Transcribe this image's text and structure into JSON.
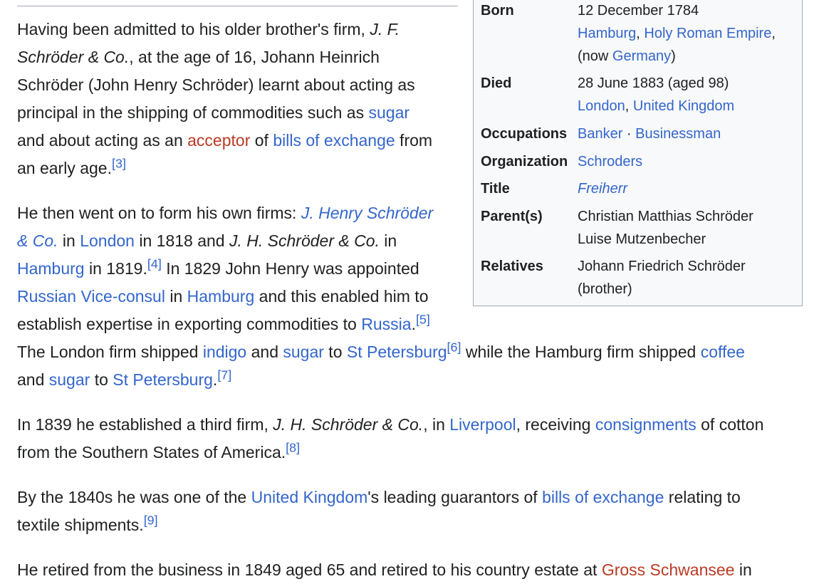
{
  "colors": {
    "link": "#3366cc",
    "new_link": "#ba3a24",
    "text": "#202122",
    "infobox_bg": "#f8f9fa",
    "border": "#a2a9b1"
  },
  "infobox": {
    "born": {
      "label": "Born",
      "date": "12 December 1784",
      "place1": "Hamburg",
      "sep1": ", ",
      "place2": "Holy Roman Empire",
      "sep2": ",",
      "now_prefix": "(now ",
      "now_link": "Germany",
      "now_suffix": ")"
    },
    "died": {
      "label": "Died",
      "date": "28 June 1883 (aged 98)",
      "place1": "London",
      "sep": ", ",
      "place2": "United Kingdom"
    },
    "occupations": {
      "label": "Occupations",
      "item1": "Banker",
      "sep": " · ",
      "item2": "Businessman"
    },
    "organization": {
      "label": "Organization",
      "value": "Schroders"
    },
    "title": {
      "label": "Title",
      "value": "Freiherr"
    },
    "parents": {
      "label": "Parent(s)",
      "parent1": "Christian Matthias Schröder",
      "parent2": "Luise Mutzenbecher"
    },
    "relatives": {
      "label": "Relatives",
      "line1": "Johann Friedrich Schröder",
      "line2": "(brother)"
    }
  },
  "p1": {
    "l1a": "Having been admitted to his older brother's firm, ",
    "l1b": "J. F.",
    "l2a": "Schröder & Co.",
    "l2b": ", at the age of 16, Johann Heinrich",
    "l3": "Schröder (John Henry Schröder) learnt about acting as",
    "l4a": "principal in the shipping of commodities such as ",
    "l4link": "sugar",
    "l5a": "and about acting as an ",
    "l5link1": "acceptor",
    "l5b": " of ",
    "l5link2": "bills of exchange",
    "l5c": " from",
    "l6a": "an early age.",
    "ref": "[3]"
  },
  "p2": {
    "l1a": "He then went on to form his own firms: ",
    "l1link": "J. Henry Schröder",
    "l2link": "& Co.",
    "l2a": " in ",
    "l2link2": "London",
    "l2b": " in 1818 and ",
    "l2it": "J. H. Schröder & Co.",
    "l2c": " in",
    "l3link": "Hamburg",
    "l3a": " in 1819.",
    "l3ref": "[4]",
    "l3b": " In 1829 John Henry was appointed",
    "l4link": "Russian Vice-consul",
    "l4a": " in ",
    "l4link2": "Hamburg",
    "l4b": " and this enabled him to",
    "l5a": "establish expertise in exporting commodities to ",
    "l5link": "Russia",
    "l5b": ".",
    "l5ref": "[5]",
    "l6a": "The London firm shipped ",
    "l6link1": "indigo",
    "l6b": " and ",
    "l6link2": "sugar",
    "l6c": " to ",
    "l6link3": "St Petersburg",
    "l6ref": "[6]",
    "l6d": " while the Hamburg firm shipped ",
    "l6link4": "coffee",
    "l7a": "and ",
    "l7link1": "sugar",
    "l7b": " to ",
    "l7link2": "St Petersburg",
    "l7c": ".",
    "l7ref": "[7]"
  },
  "p3": {
    "l1a": "In 1839 he established a third firm, ",
    "l1it": "J. H. Schröder & Co.",
    "l1b": ", in ",
    "l1link1": "Liverpool",
    "l1c": ", receiving ",
    "l1link2": "consignments",
    "l1d": " of cotton",
    "l2a": "from the Southern States of America.",
    "l2ref": "[8]"
  },
  "p4": {
    "l1a": "By the 1840s he was one of the ",
    "l1link1": "United Kingdom",
    "l1b": "'s leading guarantors of ",
    "l1link2": "bills of exchange",
    "l1c": " relating to",
    "l2a": "textile shipments.",
    "l2ref": "[9]"
  },
  "p5": {
    "l1a": "He retired from the business in 1849 aged 65 and retired to his country estate at ",
    "l1link": "Gross Schwansee",
    "l1b": " in"
  }
}
